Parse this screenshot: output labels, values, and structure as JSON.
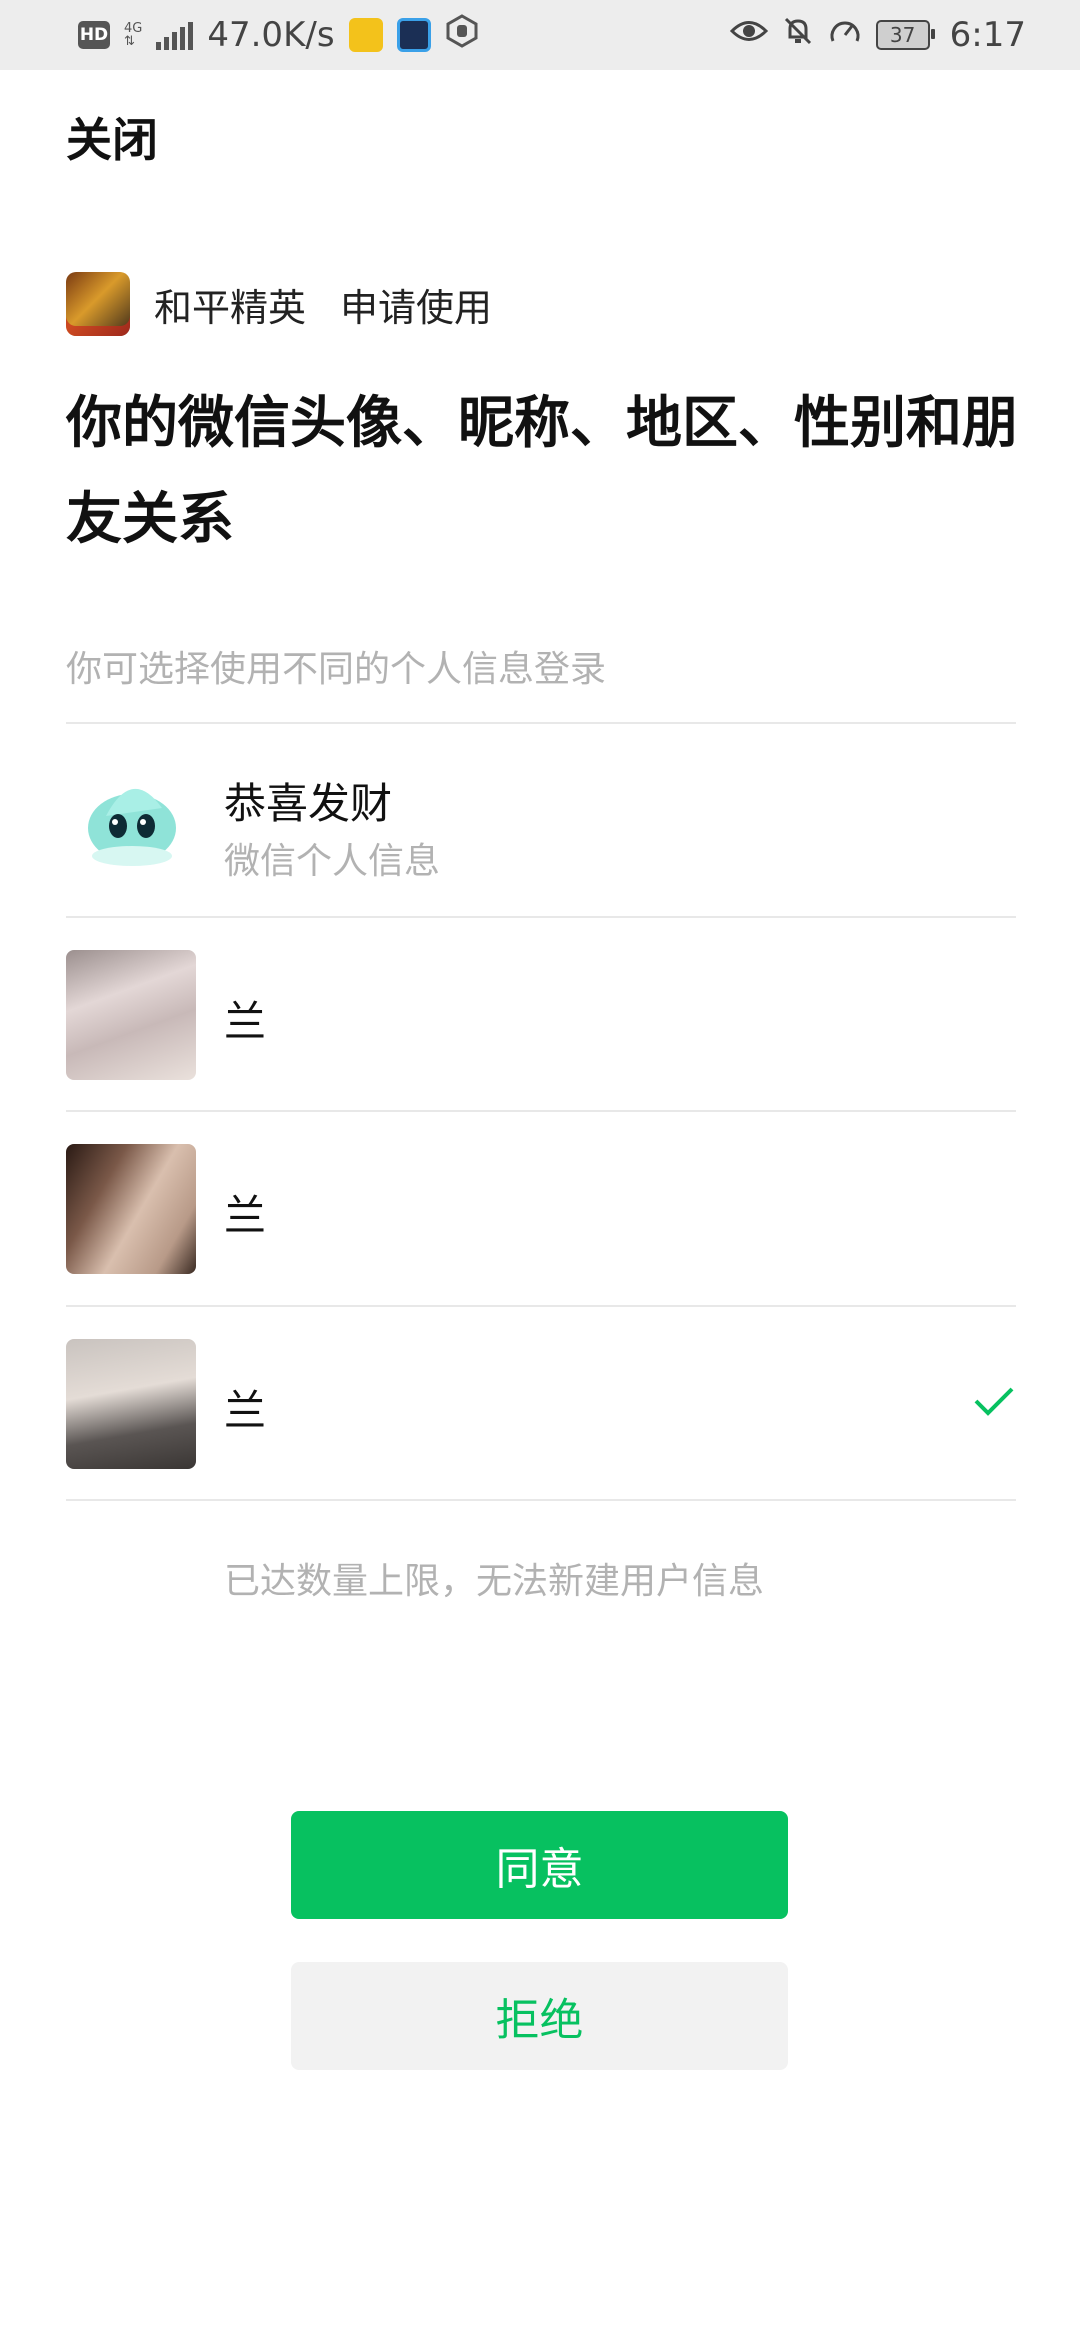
{
  "status_bar": {
    "hd_badge": "HD",
    "network_type": "4G",
    "speed": "47.0K/s",
    "battery_level": "37",
    "time": "6:17"
  },
  "header": {
    "close_label": "关闭"
  },
  "request": {
    "app_name": "和平精英",
    "request_text": "申请使用",
    "headline": "你的微信头像、昵称、地区、性别和朋友关系",
    "hint": "你可选择使用不同的个人信息登录"
  },
  "profiles": [
    {
      "name": "恭喜发财",
      "subtitle": "微信个人信息",
      "selected": false
    },
    {
      "name": "兰",
      "selected": false
    },
    {
      "name": "兰",
      "selected": false
    },
    {
      "name": "兰",
      "selected": true
    }
  ],
  "limit_note": "已达数量上限，无法新建用户信息",
  "actions": {
    "agree_label": "同意",
    "reject_label": "拒绝"
  },
  "colors": {
    "accent": "#07c160",
    "secondary_text": "#b2b2b2",
    "status_bar_bg": "#ededed"
  }
}
